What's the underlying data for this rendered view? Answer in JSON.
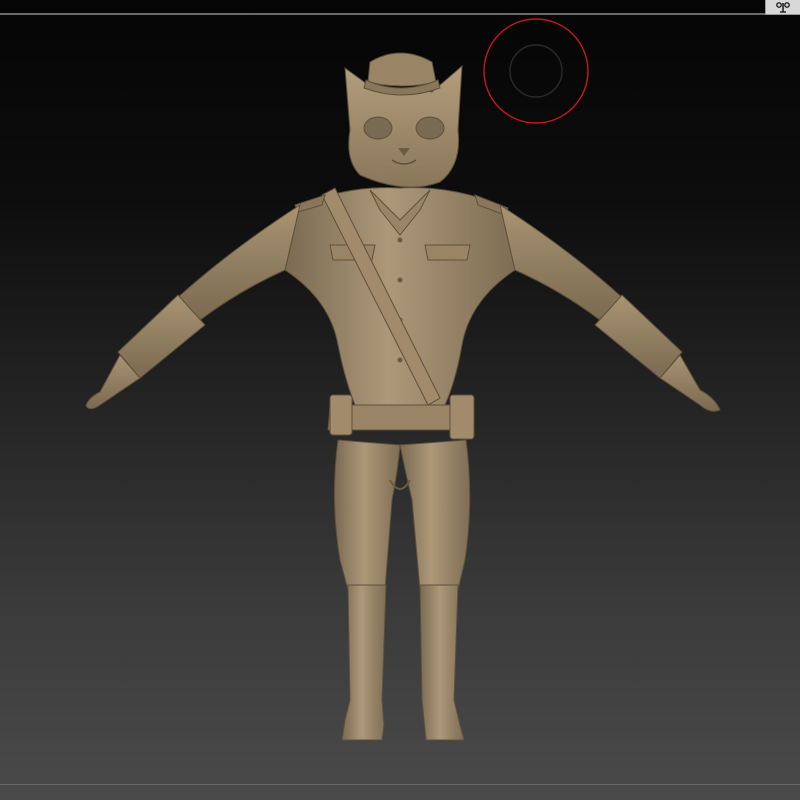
{
  "viewport": {
    "background_top": "#050505",
    "background_bottom": "#4a4a4a"
  },
  "toolbar": {
    "corner_icon": "transpose-icon"
  },
  "brush": {
    "outer_color": "#c41a1a",
    "inner_color": "#2a2a2a"
  },
  "model": {
    "subject": "cat-officer-sculpt",
    "material_color": "#a89374"
  }
}
